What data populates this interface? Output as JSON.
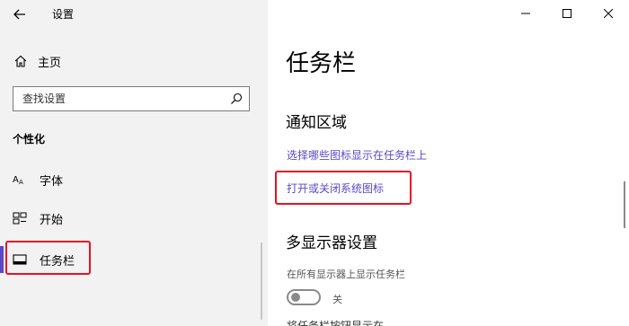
{
  "app": {
    "title": "设置",
    "window_controls": [
      "minimize",
      "maximize",
      "close"
    ]
  },
  "sidebar": {
    "home_label": "主页",
    "search_placeholder": "查找设置",
    "section_title": "个性化",
    "items": [
      {
        "label": "字体",
        "icon": "font-icon"
      },
      {
        "label": "开始",
        "icon": "start-grid-icon"
      },
      {
        "label": "任务栏",
        "icon": "taskbar-icon",
        "selected": true
      }
    ]
  },
  "main": {
    "page_title": "任务栏",
    "notification_area": {
      "heading": "通知区域",
      "links": [
        "选择哪些图标显示在任务栏上",
        "打开或关闭系统图标"
      ]
    },
    "multi_display": {
      "heading": "多显示器设置",
      "show_taskbar_label": "在所有显示器上显示任务栏",
      "toggle_state": "关",
      "toggle_on": false,
      "cut_off_text": "将任务栏按钮显示在"
    }
  },
  "colors": {
    "accent": "#5b48c5",
    "highlight_box": "#e81123",
    "sidebar_bg": "#f2f2f2"
  }
}
